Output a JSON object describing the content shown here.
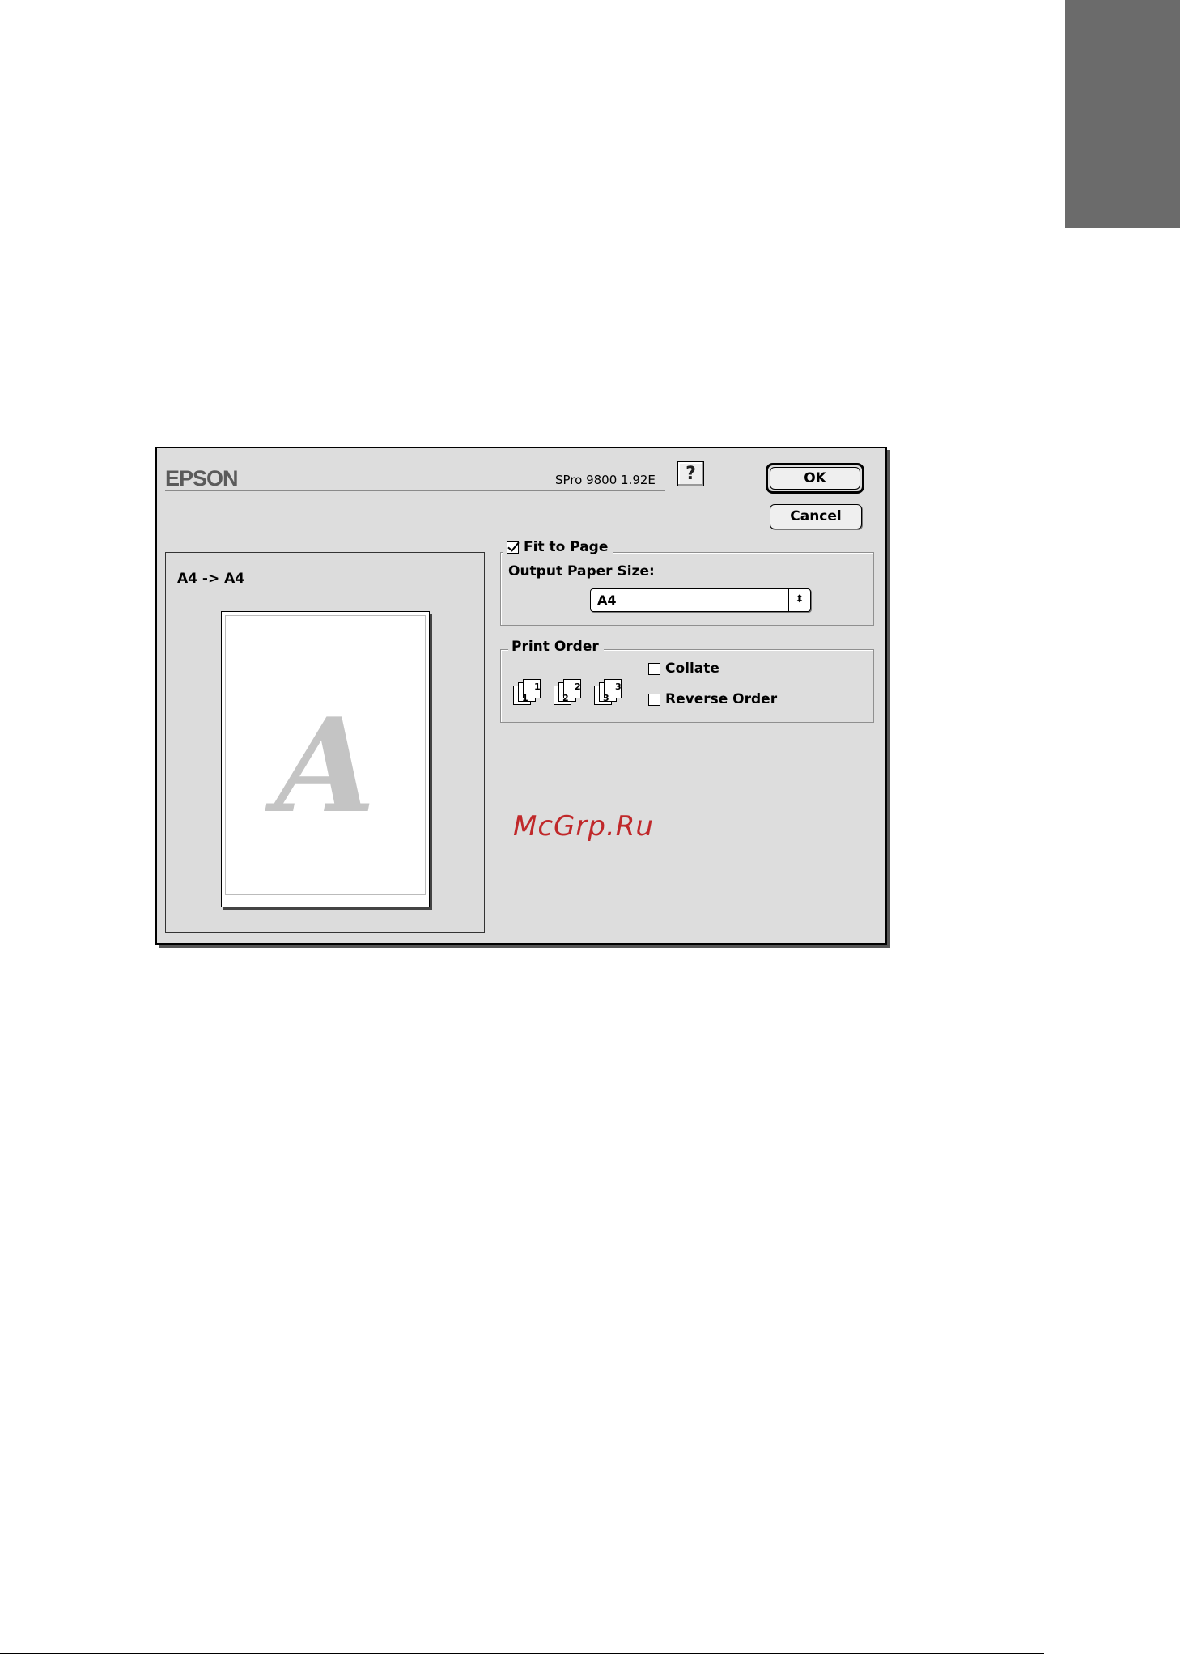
{
  "dialog": {
    "brand": "EPSON",
    "version": "SPro 9800 1.92E",
    "help_label": "?",
    "ok_label": "OK",
    "cancel_label": "Cancel"
  },
  "preview": {
    "label": "A4 -> A4",
    "glyph": "A"
  },
  "fit_to_page": {
    "label": "Fit to Page",
    "checked": true,
    "output_paper_size_label": "Output Paper Size:",
    "output_paper_size_value": "A4"
  },
  "print_order": {
    "title": "Print Order",
    "icons": [
      {
        "name": "stack-icon-1",
        "front": "1",
        "back": "1"
      },
      {
        "name": "stack-icon-2",
        "front": "2",
        "back": "2"
      },
      {
        "name": "stack-icon-3",
        "front": "3",
        "back": "3"
      }
    ],
    "collate_label": "Collate",
    "collate_checked": false,
    "reverse_label": "Reverse Order",
    "reverse_checked": false
  },
  "watermark": "McGrp.Ru",
  "colors": {
    "dialog_bg": "#dddddd",
    "side_tab": "#6b6b6b",
    "watermark": "#c0282a"
  }
}
